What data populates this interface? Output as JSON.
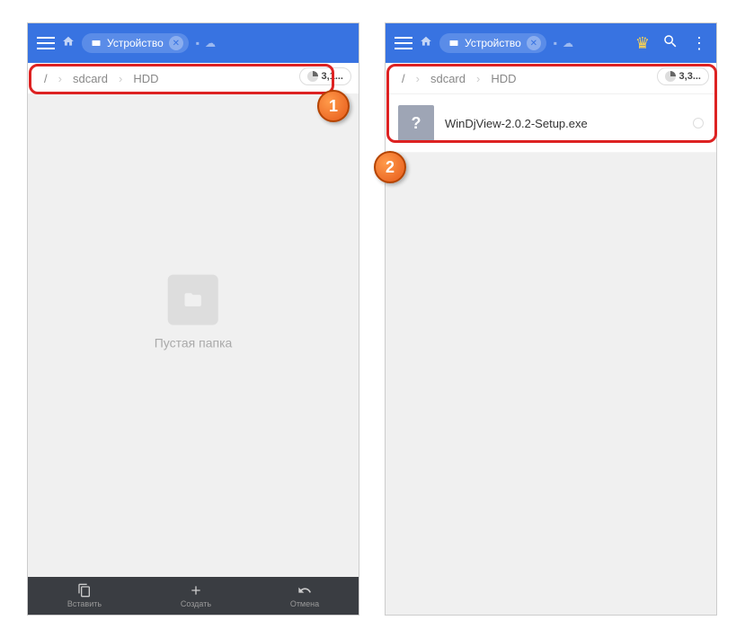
{
  "leftPhone": {
    "tab": {
      "label": "Устройство"
    },
    "breadcrumb": {
      "root": "/",
      "items": [
        "sdcard",
        "HDD"
      ]
    },
    "storage": "3,1...",
    "empty": {
      "label": "Пустая папка"
    },
    "bottombar": {
      "paste": "Вставить",
      "create": "Создать",
      "cancel": "Отмена"
    }
  },
  "rightPhone": {
    "tab": {
      "label": "Устройство"
    },
    "breadcrumb": {
      "root": "/",
      "items": [
        "sdcard",
        "HDD"
      ]
    },
    "storage": "3,3...",
    "file": {
      "name": "WinDjView-2.0.2-Setup.exe",
      "iconChar": "?"
    }
  },
  "callouts": {
    "one": "1",
    "two": "2"
  }
}
